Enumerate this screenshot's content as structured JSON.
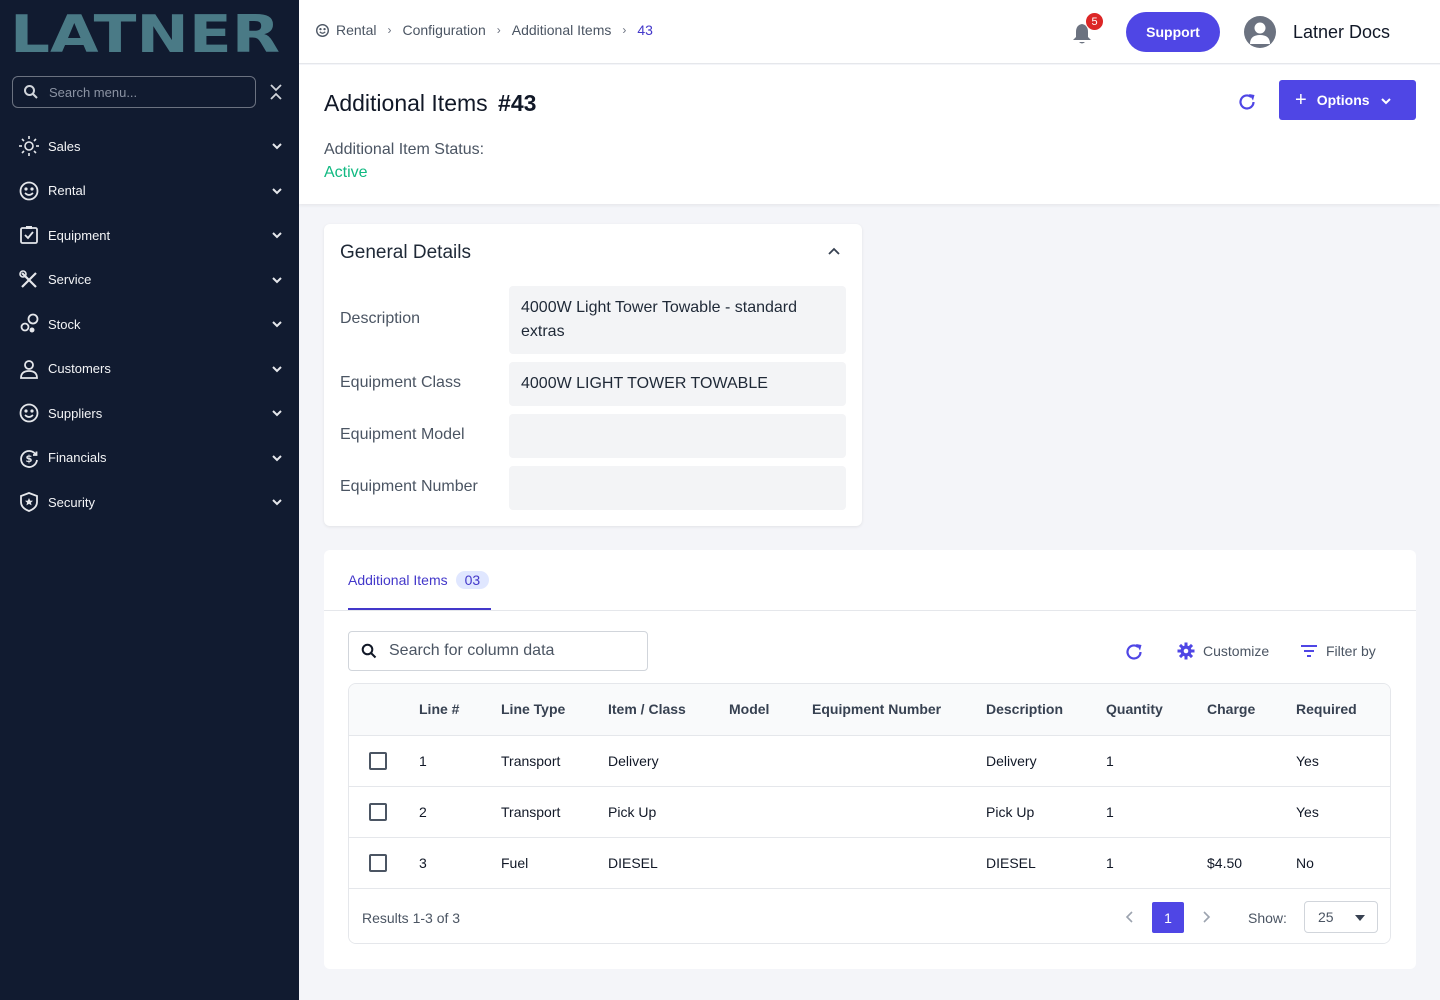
{
  "app": {
    "logo_text": "LATNER",
    "colors": {
      "sidebar_bg": "#111b30",
      "accent": "#4f46e5",
      "status_active": "#10b981",
      "logo": "#4a7a86",
      "badge": "#dc2626"
    }
  },
  "sidebar": {
    "search_placeholder": "Search menu...",
    "items": [
      {
        "label": "Sales",
        "icon": "sales-icon"
      },
      {
        "label": "Rental",
        "icon": "rental-icon"
      },
      {
        "label": "Equipment",
        "icon": "equipment-icon"
      },
      {
        "label": "Service",
        "icon": "service-icon"
      },
      {
        "label": "Stock",
        "icon": "stock-icon"
      },
      {
        "label": "Customers",
        "icon": "customers-icon"
      },
      {
        "label": "Suppliers",
        "icon": "suppliers-icon"
      },
      {
        "label": "Financials",
        "icon": "financials-icon"
      },
      {
        "label": "Security",
        "icon": "security-icon"
      }
    ]
  },
  "topbar": {
    "breadcrumb": [
      "Rental",
      "Configuration",
      "Additional Items",
      "43"
    ],
    "notification_count": "5",
    "support_label": "Support",
    "user_name": "Latner Docs"
  },
  "header": {
    "title": "Additional Items",
    "record_number": "#43",
    "options_label": "Options",
    "status_label": "Additional Item Status:",
    "status_value": "Active"
  },
  "details": {
    "title": "General Details",
    "fields": [
      {
        "label": "Description",
        "value": "4000W Light Tower Towable - standard extras"
      },
      {
        "label": "Equipment Class",
        "value": "4000W LIGHT TOWER TOWABLE"
      },
      {
        "label": "Equipment Model",
        "value": ""
      },
      {
        "label": "Equipment Number",
        "value": ""
      }
    ]
  },
  "table": {
    "tab_label": "Additional Items",
    "tab_count": "03",
    "search_placeholder": "Search for column data",
    "customize_label": "Customize",
    "filter_label": "Filter by",
    "columns": [
      "Line #",
      "Line Type",
      "Item / Class",
      "Model",
      "Equipment Number",
      "Description",
      "Quantity",
      "Charge",
      "Required"
    ],
    "rows": [
      {
        "line": "1",
        "type": "Transport",
        "item": "Delivery",
        "model": "",
        "equipment_number": "",
        "description": "Delivery",
        "quantity": "1",
        "charge": "",
        "required": "Yes"
      },
      {
        "line": "2",
        "type": "Transport",
        "item": "Pick Up",
        "model": "",
        "equipment_number": "",
        "description": "Pick Up",
        "quantity": "1",
        "charge": "",
        "required": "Yes"
      },
      {
        "line": "3",
        "type": "Fuel",
        "item": "DIESEL",
        "model": "",
        "equipment_number": "",
        "description": "DIESEL",
        "quantity": "1",
        "charge": "$4.50",
        "required": "No"
      }
    ],
    "results_text": "Results 1-3 of 3",
    "current_page": "1",
    "show_label": "Show:",
    "page_size": "25"
  }
}
